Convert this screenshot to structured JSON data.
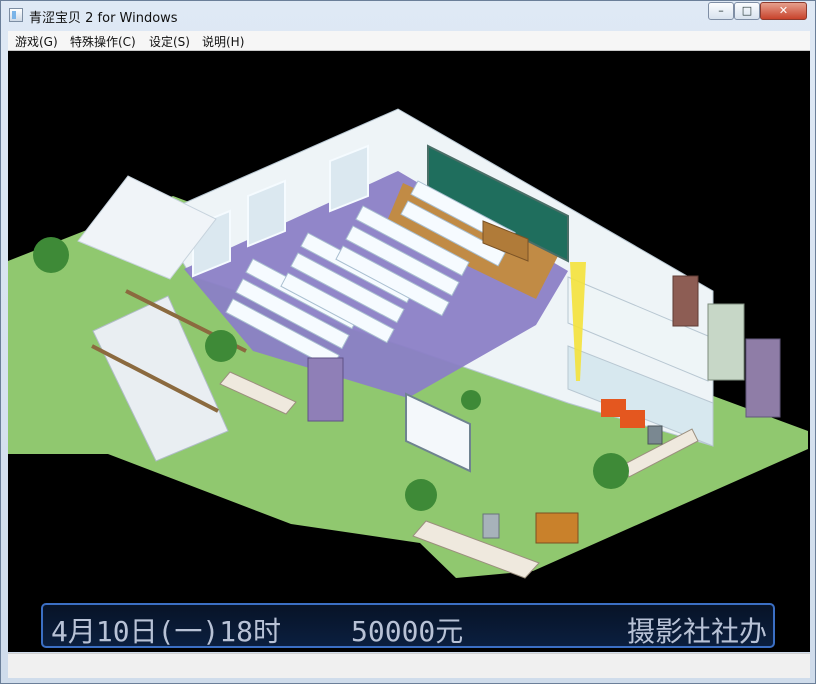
{
  "window": {
    "title": "青涩宝贝 2  for Windows",
    "minimize_glyph": "–",
    "maximize_glyph": "□",
    "close_glyph": "✕"
  },
  "menu": [
    {
      "label": "游戏(G)"
    },
    {
      "label": "特殊操作(C)"
    },
    {
      "label": "设定(S)"
    },
    {
      "label": "说明(H)"
    }
  ],
  "status": {
    "date": "4月10日(一)18时",
    "money": "50000元",
    "location": "摄影社社办"
  },
  "icons": {
    "app": "app-window-icon"
  }
}
